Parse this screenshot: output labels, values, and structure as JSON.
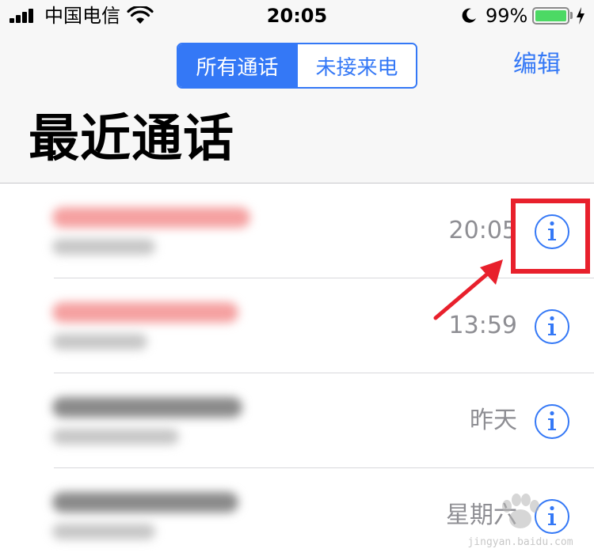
{
  "status_bar": {
    "carrier": "中国电信",
    "time": "20:05",
    "battery_percent": "99%",
    "battery_level": 0.99,
    "icons": [
      "signal-icon",
      "wifi-icon",
      "moon-icon",
      "battery-icon",
      "charging-bolt-icon"
    ]
  },
  "segmented_control": {
    "options": [
      {
        "label": "所有通话",
        "selected": true
      },
      {
        "label": "未接来电",
        "selected": false
      }
    ]
  },
  "header": {
    "edit_label": "编辑",
    "title": "最近通话"
  },
  "calls": [
    {
      "time": "20:05",
      "missed": true,
      "info_icon": "info-icon"
    },
    {
      "time": "13:59",
      "missed": true,
      "info_icon": "info-icon"
    },
    {
      "time": "昨天",
      "missed": false,
      "info_icon": "info-icon"
    },
    {
      "time": "星期六",
      "missed": false,
      "info_icon": "info-icon"
    }
  ],
  "colors": {
    "accent": "#3478f6",
    "missed": "#ff3b30",
    "annotation": "#e8202c",
    "secondary_text": "#8e8e93"
  },
  "watermark": {
    "text": "jingyan.baidu.com",
    "logo": "baidu-jingyan-logo"
  }
}
